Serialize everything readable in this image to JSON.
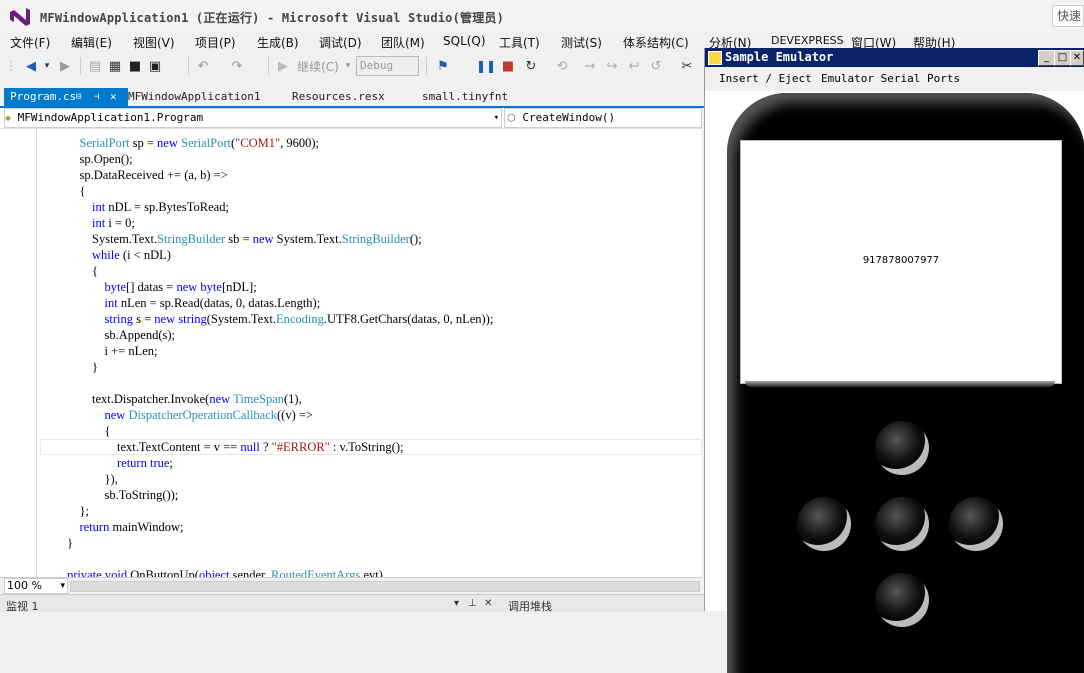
{
  "window": {
    "title": "MFWindowApplication1 (正在运行) - Microsoft Visual Studio(管理员)",
    "quick_launch": "快速"
  },
  "menubar": {
    "items": [
      "文件(F)",
      "编辑(E)",
      "视图(V)",
      "项目(P)",
      "生成(B)",
      "调试(D)",
      "团队(M)",
      "SQL(Q)",
      "工具(T)",
      "测试(S)",
      "体系结构(C)",
      "分析(N)",
      "DEVEXPRESS",
      "窗口(W)",
      "帮助(H)"
    ]
  },
  "toolbar": {
    "continue_label": "继续(C)",
    "config_value": "Debug"
  },
  "tabs": [
    {
      "label": "Program.cs",
      "active": true
    },
    {
      "label": "MFWindowApplication1",
      "active": false
    },
    {
      "label": "Resources.resx",
      "active": false
    },
    {
      "label": "small.tinyfnt",
      "active": false
    }
  ],
  "navbar": {
    "class_value": "MFWindowApplication1.Program",
    "member_value": "CreateWindow()"
  },
  "code": {
    "lines": [
      "            SerialPort sp = new SerialPort(\"COM1\", 9600);",
      "            sp.Open();",
      "            sp.DataReceived += (a, b) =>",
      "            {",
      "                int nDL = sp.BytesToRead;",
      "                int i = 0;",
      "                System.Text.StringBuilder sb = new System.Text.StringBuilder();",
      "                while (i < nDL)",
      "                {",
      "                    byte[] datas = new byte[nDL];",
      "                    int nLen = sp.Read(datas, 0, datas.Length);",
      "                    string s = new string(System.Text.Encoding.UTF8.GetChars(datas, 0, nLen));",
      "                    sb.Append(s);",
      "                    i += nLen;",
      "                }",
      "",
      "                text.Dispatcher.Invoke(new TimeSpan(1),",
      "                    new DispatcherOperationCallback((v) =>",
      "                    {",
      "                        text.TextContent = v == null ? \"#ERROR\" : v.ToString();",
      "                        return true;",
      "                    }),",
      "                    sb.ToString());",
      "            };",
      "            return mainWindow;",
      "        }",
      "",
      "        private void OnButtonUp(object sender, RoutedEventArgs evt)"
    ]
  },
  "status": {
    "zoom": "100 %",
    "watch_label": "监视 1",
    "callstack_label": "调用堆栈"
  },
  "emulator": {
    "title": "Sample Emulator",
    "menu": [
      "Insert / Eject",
      "Emulator Serial Ports"
    ],
    "screen_text": "917878007977"
  }
}
